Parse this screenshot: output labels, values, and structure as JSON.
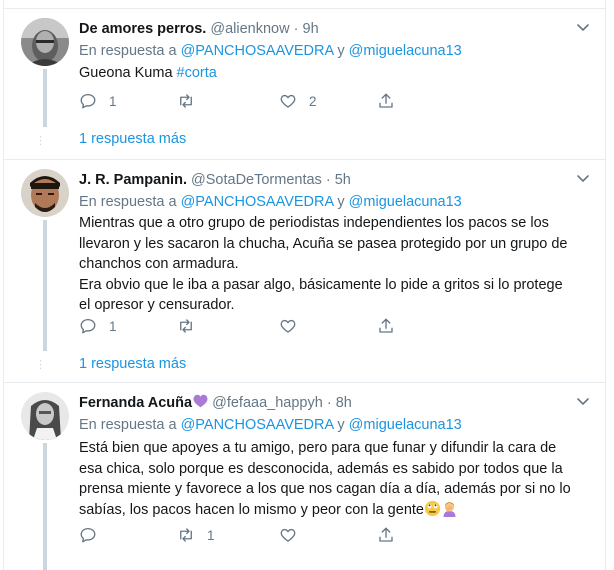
{
  "tweets": [
    {
      "name": "De amores perros.",
      "handle": "@alienknow",
      "dot": "·",
      "time": "9h",
      "reply_prefix": "En respuesta a",
      "reply_mention1": "@PANCHOSAAVEDRA",
      "reply_and": "y",
      "reply_mention2": "@miguelacuna13",
      "text": "Gueona Kuma",
      "hashtag": "#corta",
      "counts": {
        "reply": "1",
        "retweet": "",
        "like": "2"
      },
      "more_replies": "1 respuesta más"
    },
    {
      "name": "J. R. Pampanin.",
      "handle": "@SotaDeTormentas",
      "dot": "·",
      "time": "5h",
      "reply_prefix": "En respuesta a",
      "reply_mention1": "@PANCHOSAAVEDRA",
      "reply_and": "y",
      "reply_mention2": "@miguelacuna13",
      "lines": [
        "Mientras que a otro grupo de periodistas independientes los pacos se los",
        "llevaron y les sacaron la chucha, Acuña se pasea protegido por un grupo de",
        "chanchos con armadura.",
        "Era obvio que le iba a pasar algo, básicamente lo pide a gritos si lo protege",
        "el opresor y censurador."
      ],
      "counts": {
        "reply": "1",
        "retweet": "",
        "like": ""
      },
      "more_replies": "1 respuesta más"
    },
    {
      "name": "Fernanda Acuña",
      "handle": "@fefaaa_happyh",
      "dot": "·",
      "time": "8h",
      "reply_prefix": "En respuesta a",
      "reply_mention1": "@PANCHOSAAVEDRA",
      "reply_and": "y",
      "reply_mention2": "@miguelacuna13",
      "lines": [
        "Está bien que apoyes a tu amigo, pero para que funar y difundir la cara de",
        "esa chica, solo porque es desconocida, además es sabido por todos que la",
        "prensa miente y favorece a los que nos cagan día a día, además por si no lo",
        "sabías, los pacos hacen lo mismo y peor con la gente"
      ],
      "counts": {
        "reply": "",
        "retweet": "1",
        "like": ""
      }
    }
  ],
  "colors": {
    "link": "#1b95e0",
    "muted": "#657786",
    "thread": "#ccd6dd",
    "border": "#e6ecf0"
  },
  "icons": [
    "reply-icon",
    "retweet-icon",
    "like-icon",
    "share-icon",
    "caret-down-icon",
    "purple-heart-icon",
    "eye-roll-emoji-icon",
    "facepalm-emoji-icon"
  ]
}
